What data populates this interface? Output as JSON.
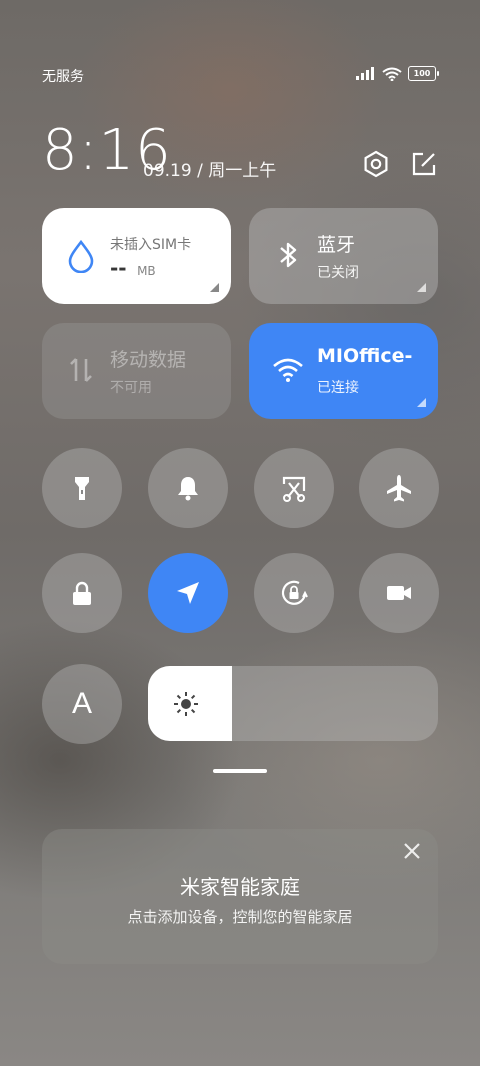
{
  "status_bar": {
    "carrier": "无服务",
    "battery": "100",
    "icons": [
      "signal-icon",
      "wifi-icon",
      "battery-icon"
    ]
  },
  "header": {
    "time": "8:16",
    "date": "09.19 / 周一上午",
    "icons": [
      "settings-icon",
      "edit-icon"
    ]
  },
  "tiles": {
    "data_usage": {
      "title": "未插入SIM卡",
      "value": "--",
      "unit": "MB",
      "icon": "drop-icon"
    },
    "bluetooth": {
      "title": "蓝牙",
      "status": "已关闭",
      "icon": "bluetooth-icon"
    },
    "mobile_data": {
      "title": "移动数据",
      "status": "不可用",
      "icon": "data-arrows-icon"
    },
    "wifi": {
      "title": "MIOffice-",
      "status": "已连接",
      "icon": "wifi-icon"
    }
  },
  "toggles": [
    {
      "name": "flashlight",
      "icon": "flashlight-icon",
      "active": false
    },
    {
      "name": "mute",
      "icon": "bell-icon",
      "active": false
    },
    {
      "name": "screenshot",
      "icon": "screenshot-icon",
      "active": false
    },
    {
      "name": "airplane",
      "icon": "airplane-icon",
      "active": false
    },
    {
      "name": "lock",
      "icon": "lock-icon",
      "active": false
    },
    {
      "name": "location",
      "icon": "location-icon",
      "active": true
    },
    {
      "name": "rotation-lock",
      "icon": "rotation-lock-icon",
      "active": false
    },
    {
      "name": "screen-record",
      "icon": "video-icon",
      "active": false
    },
    {
      "name": "font",
      "icon": "font-icon",
      "label": "A",
      "active": false
    }
  ],
  "brightness": {
    "level": 0.29,
    "icon": "sun-icon"
  },
  "mijia_card": {
    "title": "米家智能家庭",
    "subtitle": "点击添加设备，控制您的智能家居",
    "close_icon": "close-icon"
  },
  "colors": {
    "accent": "#3f86f5",
    "tile_white": "#ffffff"
  }
}
